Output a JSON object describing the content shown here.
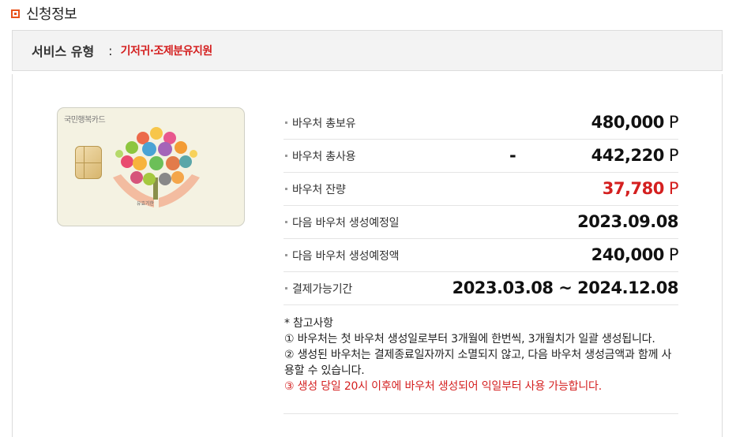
{
  "section": {
    "title": "신청정보",
    "icon": "orange-square-icon"
  },
  "service": {
    "label": "서비스 유형",
    "colon": ":",
    "value": "기저귀·조제분유지원"
  },
  "card": {
    "brand": "국민행복카드",
    "caption": "유효기한",
    "icon": "happiness-card-icon"
  },
  "rows": [
    {
      "label": "바우처 총보유",
      "value": "480,000",
      "unit": "P",
      "prefix": ""
    },
    {
      "label": "바우처 총사용",
      "value": "442,220",
      "unit": "P",
      "prefix": "-"
    },
    {
      "label": "바우처 잔량",
      "value": "37,780",
      "unit": "P",
      "prefix": ""
    },
    {
      "label": "다음 바우처 생성예정일",
      "value": "2023.09.08",
      "unit": "",
      "prefix": ""
    },
    {
      "label": "다음 바우처 생성예정액",
      "value": "240,000",
      "unit": "P",
      "prefix": ""
    },
    {
      "label": "결제가능기간",
      "value": "2023.03.08 ~ 2024.12.08",
      "unit": "",
      "prefix": ""
    }
  ],
  "notes": {
    "title": "* 참고사항",
    "items": [
      "① 바우처는 첫 바우처 생성일로부터 3개월에 한번씩, 3개월치가 일괄 생성됩니다.",
      "② 생성된 바우처는 결제종료일자까지 소멸되지 않고, 다음 바우처 생성금액과 함께 사용할 수 있습니다.",
      "③ 생성 당일 20시 이후에 바우처 생성되어 익일부터 사용 가능합니다."
    ]
  },
  "colors": {
    "accent": "#e8531b",
    "highlight": "#d41f1f",
    "card_bg": "#f4f2e2"
  }
}
